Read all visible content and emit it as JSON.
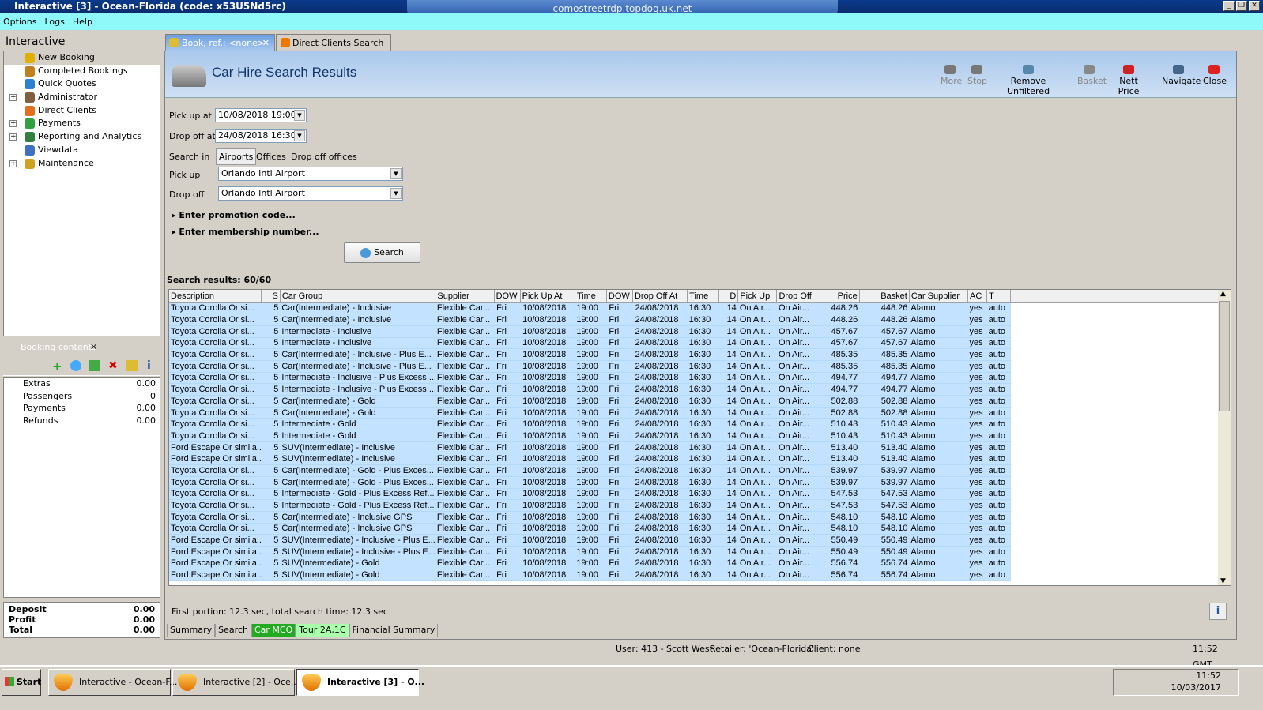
{
  "window": {
    "title": "Interactive [3] - Ocean-Florida (code: x53U5Nd5rc)",
    "rdp_host": "comostreetrdp.topdog.uk.net"
  },
  "menu": [
    "Options",
    "Logs",
    "Help"
  ],
  "nav": {
    "title": "Interactive",
    "items": [
      {
        "label": "New Booking",
        "expand": false,
        "color": "#e0b000"
      },
      {
        "label": "Completed Bookings",
        "expand": false,
        "color": "#c08020"
      },
      {
        "label": "Quick Quotes",
        "expand": false,
        "color": "#3080d0"
      },
      {
        "label": "Administrator",
        "expand": true,
        "color": "#806040"
      },
      {
        "label": "Direct Clients",
        "expand": false,
        "color": "#e07020"
      },
      {
        "label": "Payments",
        "expand": true,
        "color": "#30a040"
      },
      {
        "label": "Reporting and Analytics",
        "expand": true,
        "color": "#308040"
      },
      {
        "label": "Viewdata",
        "expand": false,
        "color": "#4070c0"
      },
      {
        "label": "Maintenance",
        "expand": true,
        "color": "#d0a020"
      }
    ]
  },
  "booking": {
    "title": "Booking contents",
    "rows": [
      {
        "label": "Extras",
        "value": "0.00"
      },
      {
        "label": "Passengers",
        "value": "0"
      },
      {
        "label": "Payments",
        "value": "0.00"
      },
      {
        "label": "Refunds",
        "value": "0.00"
      }
    ],
    "totals": [
      {
        "label": "Deposit",
        "value": "0.00"
      },
      {
        "label": "Profit",
        "value": "0.00"
      },
      {
        "label": "Total",
        "value": "0.00"
      }
    ]
  },
  "tabs": [
    {
      "label": "Book, ref.: <none>"
    },
    {
      "label": "Direct Clients Search"
    }
  ],
  "header": {
    "title": "Car Hire Search Results"
  },
  "toolbar": [
    {
      "label": "More",
      "enabled": false
    },
    {
      "label": "Stop",
      "enabled": false
    },
    {
      "label": "Remove Unfiltered",
      "enabled": true
    },
    {
      "label": "Basket",
      "enabled": false
    },
    {
      "label": "Nett Price",
      "enabled": true
    },
    {
      "label": "Navigate",
      "enabled": true
    },
    {
      "label": "Close",
      "enabled": true
    }
  ],
  "form": {
    "pickup_at_label": "Pick up at",
    "pickup_at": "10/08/2018 19:00",
    "dropoff_at_label": "Drop off at",
    "dropoff_at": "24/08/2018 16:30",
    "search_in_label": "Search in",
    "search_in": [
      "Airports",
      "Offices",
      "Drop off offices"
    ],
    "pickup_label": "Pick up",
    "pickup": "Orlando Intl Airport",
    "dropoff_label": "Drop off",
    "dropoff": "Orlando Intl Airport",
    "promo": "Enter promotion code...",
    "membership": "Enter membership number...",
    "search_button": "Search"
  },
  "results": {
    "summary": "Search results: 60/60",
    "columns": [
      "Description",
      "S",
      "Car Group",
      "Supplier",
      "DOW",
      "Pick Up At",
      "Time",
      "DOW",
      "Drop Off At",
      "Time",
      "D",
      "Pick Up",
      "Drop Off",
      "Price",
      "Basket",
      "Car Supplier",
      "AC",
      "T"
    ],
    "common": {
      "seats": "5",
      "supplier": "Flexible Car...",
      "pu_dow": "Fri",
      "pu_date": "10/08/2018",
      "pu_time": "19:00",
      "do_dow": "Fri",
      "do_date": "24/08/2018",
      "do_time": "16:30",
      "days": "14",
      "pick_up": "On Air...",
      "drop_off": "On Air...",
      "car_supplier": "Alamo",
      "ac": "yes",
      "t": "auto"
    },
    "rows": [
      [
        "Toyota Corolla Or si...",
        "Car(Intermediate) - Inclusive",
        "448.26"
      ],
      [
        "Toyota Corolla Or si...",
        "Car(Intermediate) - Inclusive",
        "448.26"
      ],
      [
        "Toyota Corolla Or si...",
        "Intermediate - Inclusive",
        "457.67"
      ],
      [
        "Toyota Corolla Or si...",
        "Intermediate - Inclusive",
        "457.67"
      ],
      [
        "Toyota Corolla Or si...",
        "Car(Intermediate) - Inclusive - Plus E...",
        "485.35"
      ],
      [
        "Toyota Corolla Or si...",
        "Car(Intermediate) - Inclusive - Plus E...",
        "485.35"
      ],
      [
        "Toyota Corolla Or si...",
        "Intermediate - Inclusive - Plus Excess ...",
        "494.77"
      ],
      [
        "Toyota Corolla Or si...",
        "Intermediate - Inclusive - Plus Excess ...",
        "494.77"
      ],
      [
        "Toyota Corolla Or si...",
        "Car(Intermediate) - Gold",
        "502.88"
      ],
      [
        "Toyota Corolla Or si...",
        "Car(Intermediate) - Gold",
        "502.88"
      ],
      [
        "Toyota Corolla Or si...",
        "Intermediate - Gold",
        "510.43"
      ],
      [
        "Toyota Corolla Or si...",
        "Intermediate - Gold",
        "510.43"
      ],
      [
        "Ford Escape Or simila...",
        "SUV(Intermediate) - Inclusive",
        "513.40"
      ],
      [
        "Ford Escape Or simila...",
        "SUV(Intermediate) - Inclusive",
        "513.40"
      ],
      [
        "Toyota Corolla Or si...",
        "Car(Intermediate) - Gold - Plus Exces...",
        "539.97"
      ],
      [
        "Toyota Corolla Or si...",
        "Car(Intermediate) - Gold - Plus Exces...",
        "539.97"
      ],
      [
        "Toyota Corolla Or si...",
        "Intermediate - Gold - Plus Excess Ref...",
        "547.53"
      ],
      [
        "Toyota Corolla Or si...",
        "Intermediate - Gold - Plus Excess Ref...",
        "547.53"
      ],
      [
        "Toyota Corolla Or si...",
        "Car(Intermediate) - Inclusive GPS",
        "548.10"
      ],
      [
        "Toyota Corolla Or si...",
        "Car(Intermediate) - Inclusive GPS",
        "548.10"
      ],
      [
        "Ford Escape Or simila...",
        "SUV(Intermediate) - Inclusive - Plus E...",
        "550.49"
      ],
      [
        "Ford Escape Or simila...",
        "SUV(Intermediate) - Inclusive - Plus E...",
        "550.49"
      ],
      [
        "Ford Escape Or simila...",
        "SUV(Intermediate) - Gold",
        "556.74"
      ],
      [
        "Ford Escape Or simila...",
        "SUV(Intermediate) - Gold",
        "556.74"
      ]
    ],
    "timing": "First portion: 12.3 sec, total search time: 12.3 sec"
  },
  "bottom_tabs": [
    {
      "label": "Summary",
      "bg": ""
    },
    {
      "label": "Search",
      "bg": ""
    },
    {
      "label": "Car MCO",
      "bg": "#22aa22"
    },
    {
      "label": "Tour 2A,1C",
      "bg": "#aaffaa"
    },
    {
      "label": "Financial Summary",
      "bg": ""
    }
  ],
  "status": {
    "user": "User: 413 - Scott West",
    "retailer": "Retailer: 'Ocean-Florida'",
    "client": "Client: none",
    "time": "11:52 GMT"
  },
  "taskbar": {
    "start": "Start",
    "tasks": [
      "Interactive - Ocean-F...",
      "Interactive [2] - Oce...",
      "Interactive [3] - O..."
    ],
    "clock_time": "11:52",
    "clock_date": "10/03/2017"
  }
}
